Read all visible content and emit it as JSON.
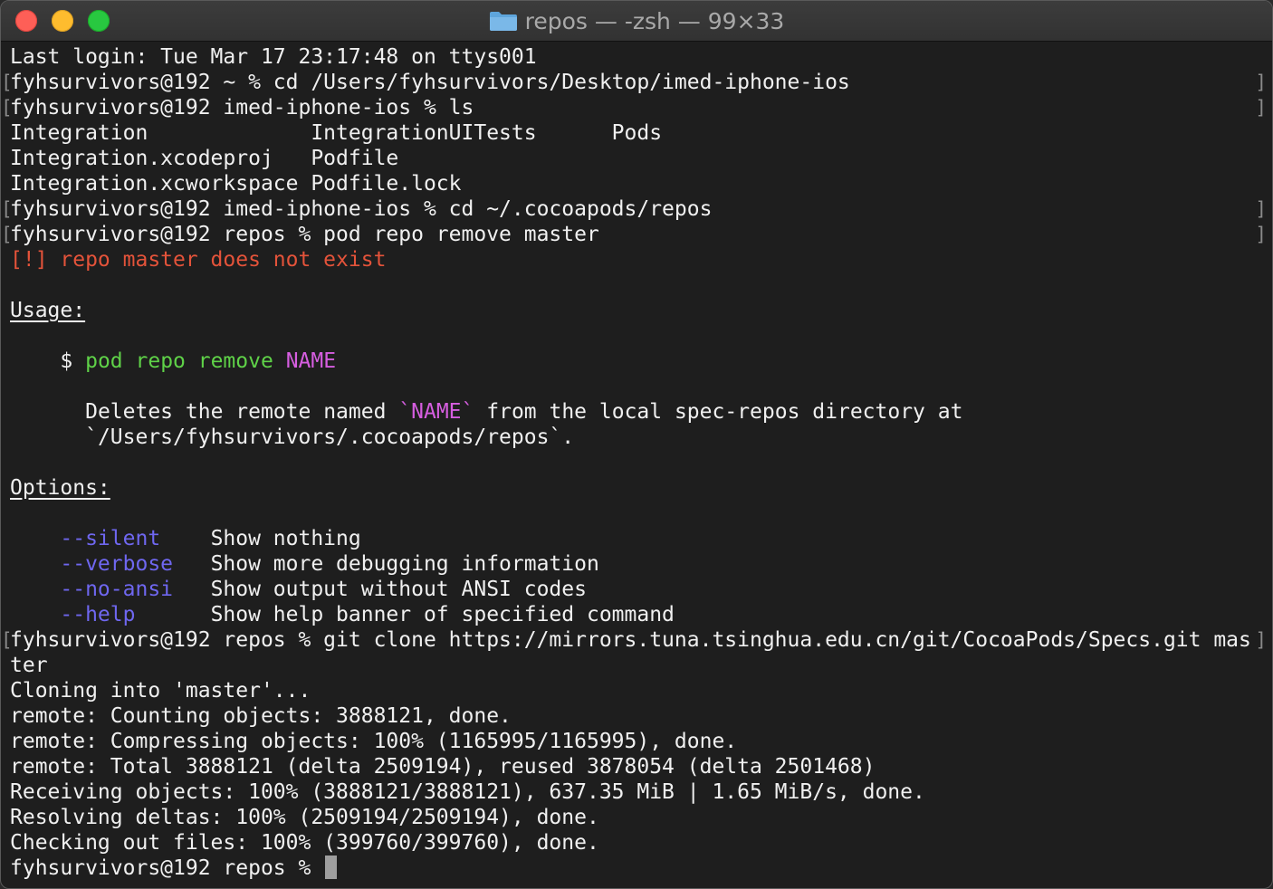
{
  "window": {
    "title": "repos — -zsh — 99×33",
    "colors": {
      "close": "#fe5f57",
      "minimize": "#febc2e",
      "zoom": "#28c840",
      "folder": "#7ab8e8"
    }
  },
  "terminal": {
    "colors": {
      "error": "#e4533a",
      "command": "#5fd248",
      "param": "#d65ee0",
      "option": "#6f67f0"
    },
    "lines": {
      "l1": "Last login: Tue Mar 17 23:17:48 on ttys001",
      "l2": "fyhsurvivors@192 ~ % cd /Users/fyhsurvivors/Desktop/imed-iphone-ios",
      "l3": "fyhsurvivors@192 imed-iphone-ios % ls",
      "ls": [
        [
          "Integration",
          "IntegrationUITests",
          "Pods"
        ],
        [
          "Integration.xcodeproj",
          "Podfile"
        ],
        [
          "Integration.xcworkspace",
          "Podfile.lock"
        ]
      ],
      "l7": "fyhsurvivors@192 imed-iphone-ios % cd ~/.cocoapods/repos",
      "l8": "fyhsurvivors@192 repos % pod repo remove master",
      "error": "[!] repo master does not exist",
      "usage_heading": "Usage:",
      "usage_dollar": "$",
      "usage_cmd": "pod repo remove",
      "usage_param": "NAME",
      "desc_a": "Deletes the remote named",
      "desc_name": "`NAME`",
      "desc_b": "from the local spec-repos directory at",
      "desc_path": "`/Users/fyhsurvivors/.cocoapods/repos`.",
      "options_heading": "Options:",
      "options": [
        {
          "flag": "--silent",
          "desc": "Show nothing"
        },
        {
          "flag": "--verbose",
          "desc": "Show more debugging information"
        },
        {
          "flag": "--no-ansi",
          "desc": "Show output without ANSI codes"
        },
        {
          "flag": "--help",
          "desc": "Show help banner of specified command"
        }
      ],
      "clone_a": "fyhsurvivors@192 repos % git clone https://mirrors.tuna.tsinghua.edu.cn/git/CocoaPods/Specs.git mas",
      "clone_b": "ter",
      "out": [
        "Cloning into 'master'...",
        "remote: Counting objects: 3888121, done.",
        "remote: Compressing objects: 100% (1165995/1165995), done.",
        "remote: Total 3888121 (delta 2509194), reused 3878054 (delta 2501468)",
        "Receiving objects: 100% (3888121/3888121), 637.35 MiB | 1.65 MiB/s, done.",
        "Resolving deltas: 100% (2509194/2509194), done.",
        "Checking out files: 100% (399760/399760), done."
      ],
      "prompt": "fyhsurvivors@192 repos % "
    }
  }
}
